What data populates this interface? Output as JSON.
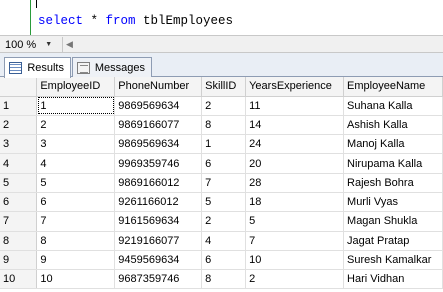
{
  "editor": {
    "keyword_select": "select",
    "star": " * ",
    "keyword_from": "from",
    "table_name": " tblEmployees"
  },
  "zoom": {
    "value": "100 %"
  },
  "tabs": [
    {
      "label": "Results",
      "icon": "grid-icon"
    },
    {
      "label": "Messages",
      "icon": "messages-icon"
    }
  ],
  "grid": {
    "columns": [
      "EmployeeID",
      "PhoneNumber",
      "SkillID",
      "YearsExperience",
      "EmployeeName"
    ],
    "rows": [
      [
        "1",
        "1",
        "9869569634",
        "2",
        "11",
        "Suhana Kalla"
      ],
      [
        "2",
        "2",
        "9869166077",
        "8",
        "14",
        "Ashish Kalla"
      ],
      [
        "3",
        "3",
        "9869569634",
        "1",
        "24",
        "Manoj Kalla"
      ],
      [
        "4",
        "4",
        "9969359746",
        "6",
        "20",
        "Nirupama Kalla"
      ],
      [
        "5",
        "5",
        "9869166012",
        "7",
        "28",
        "Rajesh Bohra"
      ],
      [
        "6",
        "6",
        "9261166012",
        "5",
        "18",
        "Murli Vyas"
      ],
      [
        "7",
        "7",
        "9161569634",
        "2",
        "5",
        "Magan Shukla"
      ],
      [
        "8",
        "8",
        "9219166077",
        "4",
        "7",
        "Jagat Pratap"
      ],
      [
        "9",
        "9",
        "9459569634",
        "6",
        "10",
        "Suresh Kamalkar"
      ],
      [
        "10",
        "10",
        "9687359746",
        "8",
        "2",
        "Hari Vidhan"
      ]
    ]
  },
  "colors": {
    "keyword": "#0000ff",
    "grid_header_bg": "#f4f4f4",
    "tab_border": "#8e9cb3"
  }
}
